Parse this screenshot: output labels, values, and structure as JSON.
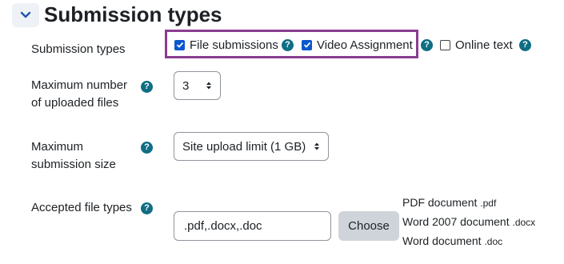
{
  "section": {
    "title": "Submission types"
  },
  "submission_types": {
    "label": "Submission types",
    "options": [
      {
        "label": "File submissions",
        "checked": true
      },
      {
        "label": "Video Assignment",
        "checked": true
      },
      {
        "label": "Online text",
        "checked": false
      }
    ]
  },
  "max_files": {
    "label_line1": "Maximum number",
    "label_line2": "of uploaded files",
    "value": "3"
  },
  "max_size": {
    "label_line1": "Maximum",
    "label_line2": "submission size",
    "value": "Site upload limit (1 GB)"
  },
  "accepted_types": {
    "label": "Accepted file types",
    "input_value": ".pdf,.docx,.doc",
    "choose_label": "Choose",
    "types": [
      {
        "name": "PDF document",
        "ext": ".pdf"
      },
      {
        "name": "Word 2007 document",
        "ext": ".docx"
      },
      {
        "name": "Word document",
        "ext": ".doc"
      }
    ]
  },
  "help_icon_glyph": "?",
  "colors": {
    "help_icon": "#0f6e84",
    "highlight_border": "#8c3d91",
    "checkbox_checked": "#0b57d0",
    "choose_button": "#ced4da"
  }
}
